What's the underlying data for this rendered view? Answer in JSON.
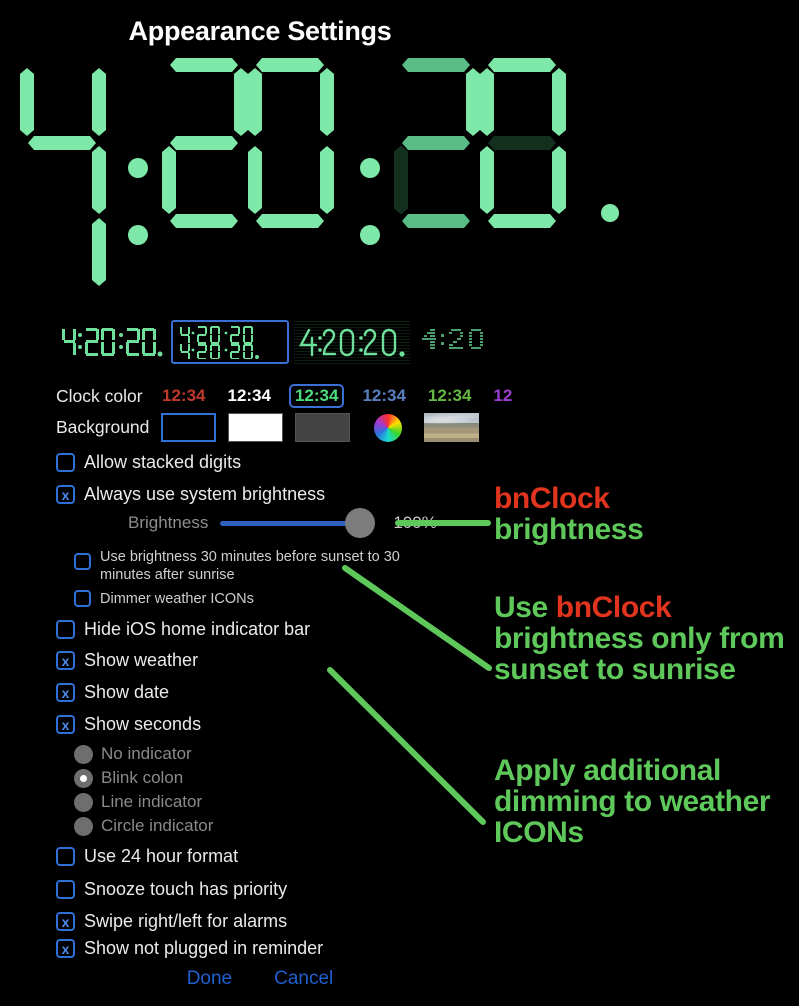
{
  "header": {
    "title": "Appearance Settings"
  },
  "clock": {
    "big_time": "4:20:20",
    "digits": [
      "4",
      "2",
      "0",
      "2",
      "0"
    ],
    "has_decimal": true,
    "previews": [
      {
        "name": "seven-segment",
        "time": "4:20:20.",
        "selected": false
      },
      {
        "name": "stacked-digits",
        "time": "4:20:20.",
        "selected": true
      },
      {
        "name": "thin-lcd",
        "time": "4:20:20.",
        "selected": false
      },
      {
        "name": "dot-matrix",
        "time": "4:20",
        "selected": false
      }
    ]
  },
  "clock_color": {
    "label": "Clock color",
    "sample": "12:34",
    "last_sample": "12",
    "options": [
      {
        "name": "red",
        "hex": "#c0392b",
        "selected": false,
        "text": "12:34"
      },
      {
        "name": "white",
        "hex": "#ffffff",
        "selected": false,
        "text": "12:34"
      },
      {
        "name": "green",
        "hex": "#4ddb7f",
        "selected": true,
        "text": "12:34"
      },
      {
        "name": "blue",
        "hex": "#5a7fbf",
        "selected": false,
        "text": "12:34"
      },
      {
        "name": "lime",
        "hex": "#64b843",
        "selected": false,
        "text": "12:34"
      },
      {
        "name": "purple",
        "hex": "#9b3fd1",
        "selected": false,
        "text": "12"
      }
    ]
  },
  "background": {
    "label": "Background",
    "options": [
      {
        "name": "black",
        "selected": true
      },
      {
        "name": "white",
        "selected": false
      },
      {
        "name": "gray",
        "selected": false
      },
      {
        "name": "color-wheel",
        "selected": false
      },
      {
        "name": "photo",
        "selected": false
      }
    ]
  },
  "settings": {
    "allow_stacked_digits": {
      "label": "Allow stacked digits",
      "checked": false
    },
    "always_system_brightness": {
      "label": "Always use system brightness",
      "checked": true
    },
    "use_brightness_sunset": {
      "label": "Use brightness 30 minutes before sunset to 30 minutes after sunrise",
      "checked": false
    },
    "dimmer_weather_icons": {
      "label": "Dimmer weather ICONs",
      "checked": false
    },
    "hide_home_indicator": {
      "label": "Hide iOS home indicator bar",
      "checked": false
    },
    "show_weather": {
      "label": "Show weather",
      "checked": true
    },
    "show_date": {
      "label": "Show date",
      "checked": true
    },
    "show_seconds": {
      "label": "Show seconds",
      "checked": true
    },
    "use_24_hour": {
      "label": "Use 24 hour format",
      "checked": false
    },
    "snooze_priority": {
      "label": "Snooze touch has priority",
      "checked": false
    },
    "swipe_alarms": {
      "label": "Swipe right/left for alarms",
      "checked": true
    },
    "not_plugged_reminder": {
      "label": "Show not plugged in reminder",
      "checked": true
    }
  },
  "brightness": {
    "label": "Brightness",
    "value": "100%",
    "percent": 100
  },
  "indicator": {
    "options": [
      {
        "label": "No indicator",
        "selected": false
      },
      {
        "label": "Blink colon",
        "selected": true
      },
      {
        "label": "Line indicator",
        "selected": false
      },
      {
        "label": "Circle indicator",
        "selected": false
      }
    ]
  },
  "buttons": {
    "done": "Done",
    "cancel": "Cancel"
  },
  "annotations": [
    {
      "name": "brightness-note",
      "line1_pre": "",
      "highlight": "bnClock",
      "line1_post": "",
      "line2": "brightness"
    },
    {
      "name": "sunset-note",
      "text": "Use bnClock brightness only from sunset to sunrise",
      "highlight": "bnClock"
    },
    {
      "name": "dimming-note",
      "text": "Apply additional dimming to weather ICONs"
    }
  ],
  "colors": {
    "accent_blue": "#2f6fd8",
    "anno_green": "#5ec85a",
    "anno_red": "#e0341f",
    "lcd_green": "#7ee8a8"
  }
}
